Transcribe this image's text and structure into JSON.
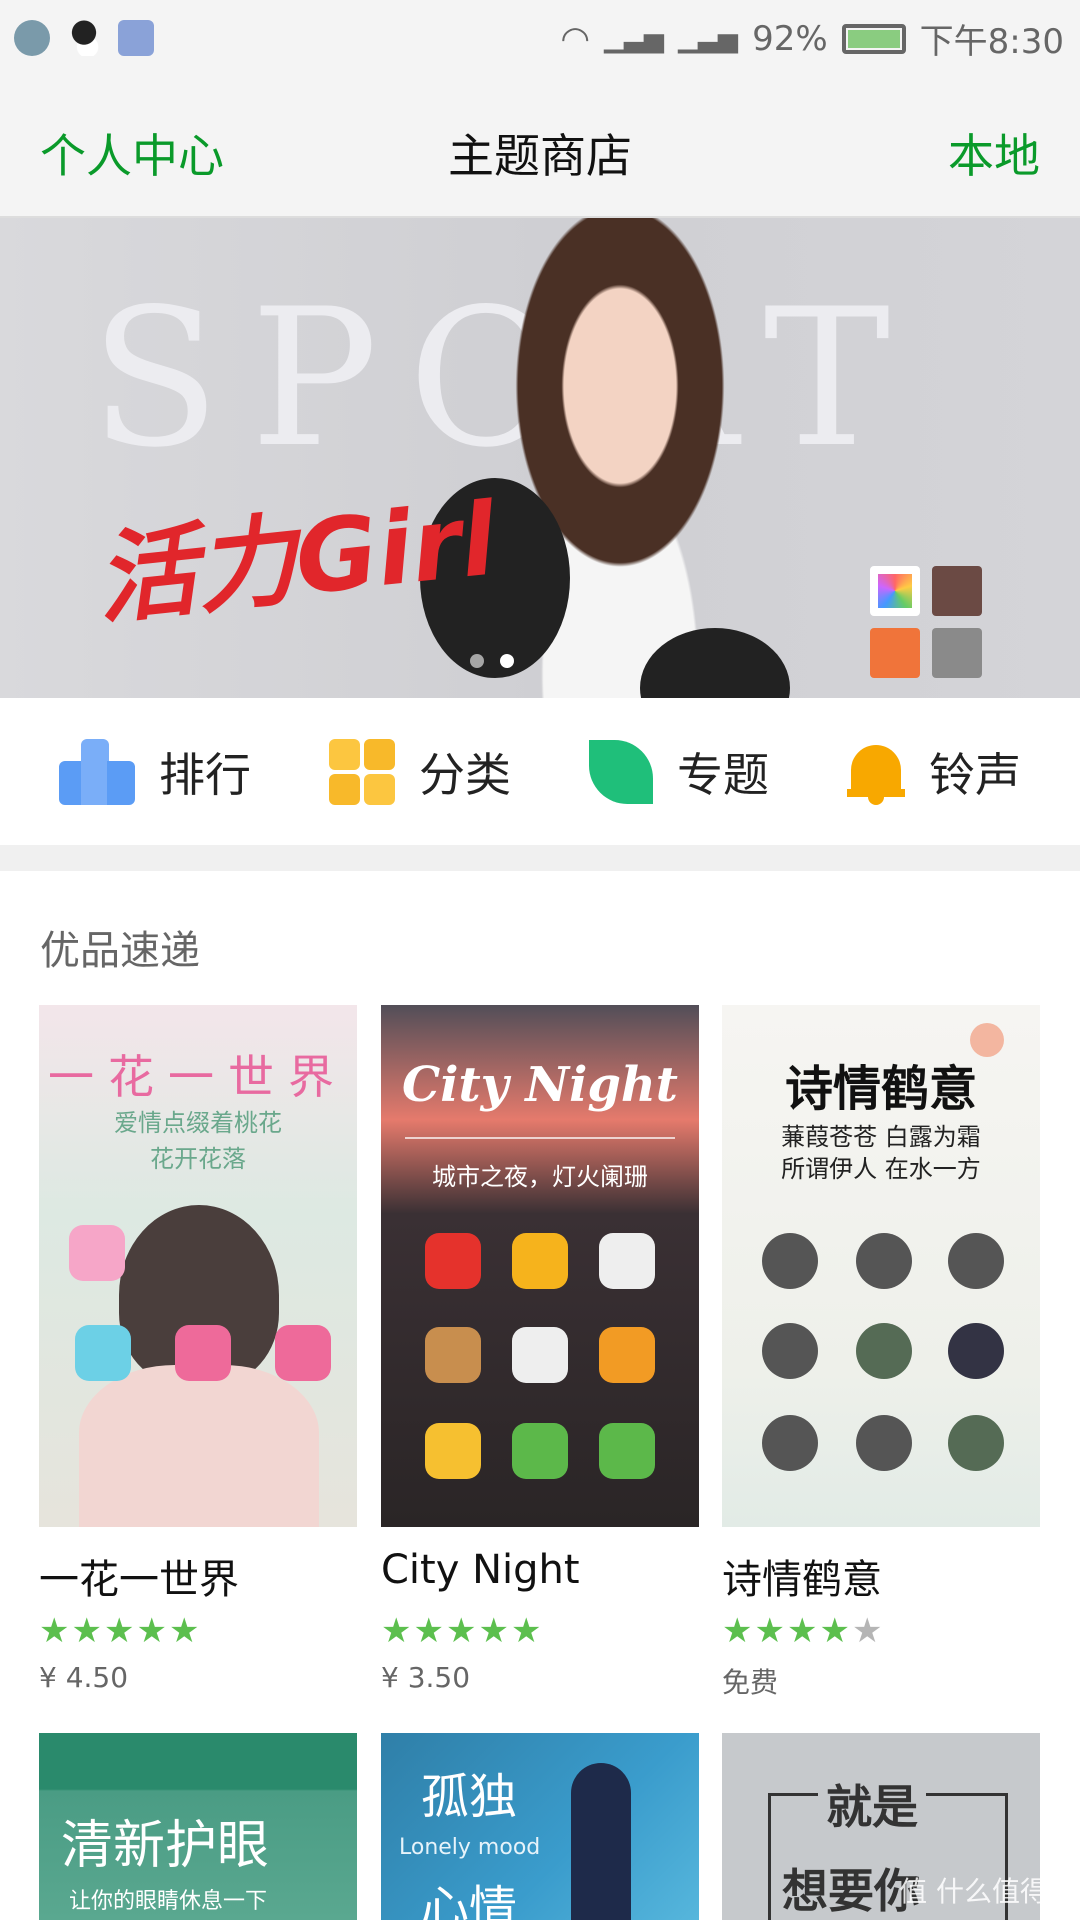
{
  "status_bar": {
    "battery": "92%",
    "time": "下午8:30",
    "icons": [
      "gallery-icon",
      "qq-icon",
      "weather-icon",
      "wifi-icon",
      "signal-icon",
      "signal-icon",
      "battery-icon"
    ]
  },
  "header": {
    "left": "个人中心",
    "title": "主题商店",
    "right": "本地"
  },
  "banner": {
    "bg_text": "SPORT",
    "slogan": "活力Girl",
    "page_count": 2,
    "active_page": 1
  },
  "categories": [
    {
      "label": "排行",
      "icon": "ranking-bar-icon",
      "color": "#5b9cf5"
    },
    {
      "label": "分类",
      "icon": "grid-icon",
      "color": "#f8b92a"
    },
    {
      "label": "专题",
      "icon": "leaf-icon",
      "color": "#1fbf7a"
    },
    {
      "label": "铃声",
      "icon": "bell-icon",
      "color": "#f8a800"
    }
  ],
  "section": {
    "title": "优品速递"
  },
  "themes": [
    {
      "name": "一花一世界",
      "rating": 5,
      "price": "¥ 4.50",
      "art_title": "一花一世界",
      "art_sub1": "爱情点缀着桃花",
      "art_sub2": "花开花落"
    },
    {
      "name": "City Night",
      "rating": 5,
      "price": "¥ 3.50",
      "art_title": "City Night",
      "art_sub1": "城市之夜，灯火阑珊",
      "art_sub2": ""
    },
    {
      "name": "诗情鹤意",
      "rating": 4,
      "price": "免费",
      "art_title": "诗情鹤意",
      "art_sub1": "蒹葭苍苍 白露为霜",
      "art_sub2": "所谓伊人 在水一方"
    }
  ],
  "themes_row2": [
    {
      "art_title": "清新护眼",
      "art_sub": "让你的眼睛休息一下"
    },
    {
      "art_title": "孤独",
      "art_sub": "Lonely mood",
      "art_title2": "心情"
    },
    {
      "art_title": "就是",
      "art_title2": "想要你"
    }
  ],
  "watermark": "值 什么值得买",
  "colors": {
    "accent": "#0a9a2a",
    "star": "#5cbf4e"
  }
}
